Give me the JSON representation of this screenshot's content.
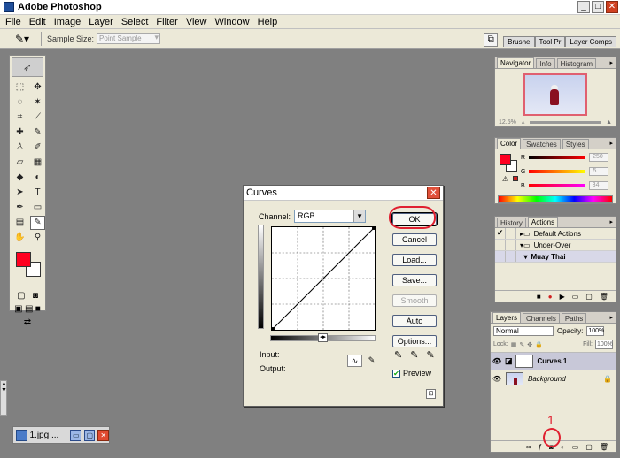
{
  "app": {
    "title": "Adobe Photoshop"
  },
  "menu": [
    "File",
    "Edit",
    "Image",
    "Layer",
    "Select",
    "Filter",
    "View",
    "Window",
    "Help"
  ],
  "options": {
    "sample_size_label": "Sample Size:",
    "sample_size_value": "Point Sample"
  },
  "palette_well": {
    "tabs": [
      "Brushe",
      "Tool Pr",
      "Layer Comps"
    ]
  },
  "document": {
    "title": "1.jpg ..."
  },
  "curves": {
    "title": "Curves",
    "channel_label": "Channel:",
    "channel_value": "RGB",
    "buttons": {
      "ok": "OK",
      "cancel": "Cancel",
      "load": "Load...",
      "save": "Save...",
      "smooth": "Smooth",
      "auto": "Auto",
      "options": "Options..."
    },
    "input_label": "Input:",
    "output_label": "Output:",
    "preview_label": "Preview",
    "preview_checked": true
  },
  "navigator": {
    "tabs": [
      "Navigator",
      "Info",
      "Histogram"
    ],
    "zoom": "12.5%"
  },
  "color": {
    "tabs": [
      "Color",
      "Swatches",
      "Styles"
    ],
    "r_label": "R",
    "r_value": "250",
    "g_label": "G",
    "g_value": "5",
    "b_label": "B",
    "b_value": "34",
    "foreground": "#ff0020"
  },
  "history": {
    "tabs": [
      "History",
      "Actions"
    ],
    "items": [
      "Default Actions",
      "Under-Over",
      "Muay Thai"
    ]
  },
  "layers": {
    "tabs": [
      "Layers",
      "Channels",
      "Paths"
    ],
    "blend_mode": "Normal",
    "opacity_label": "Opacity:",
    "opacity": "100%",
    "lock_label": "Lock:",
    "fill_label": "Fill:",
    "fill": "100%",
    "items": [
      "Curves 1",
      "Background"
    ]
  },
  "annotation": {
    "number": "1",
    "color": "#e02030"
  }
}
